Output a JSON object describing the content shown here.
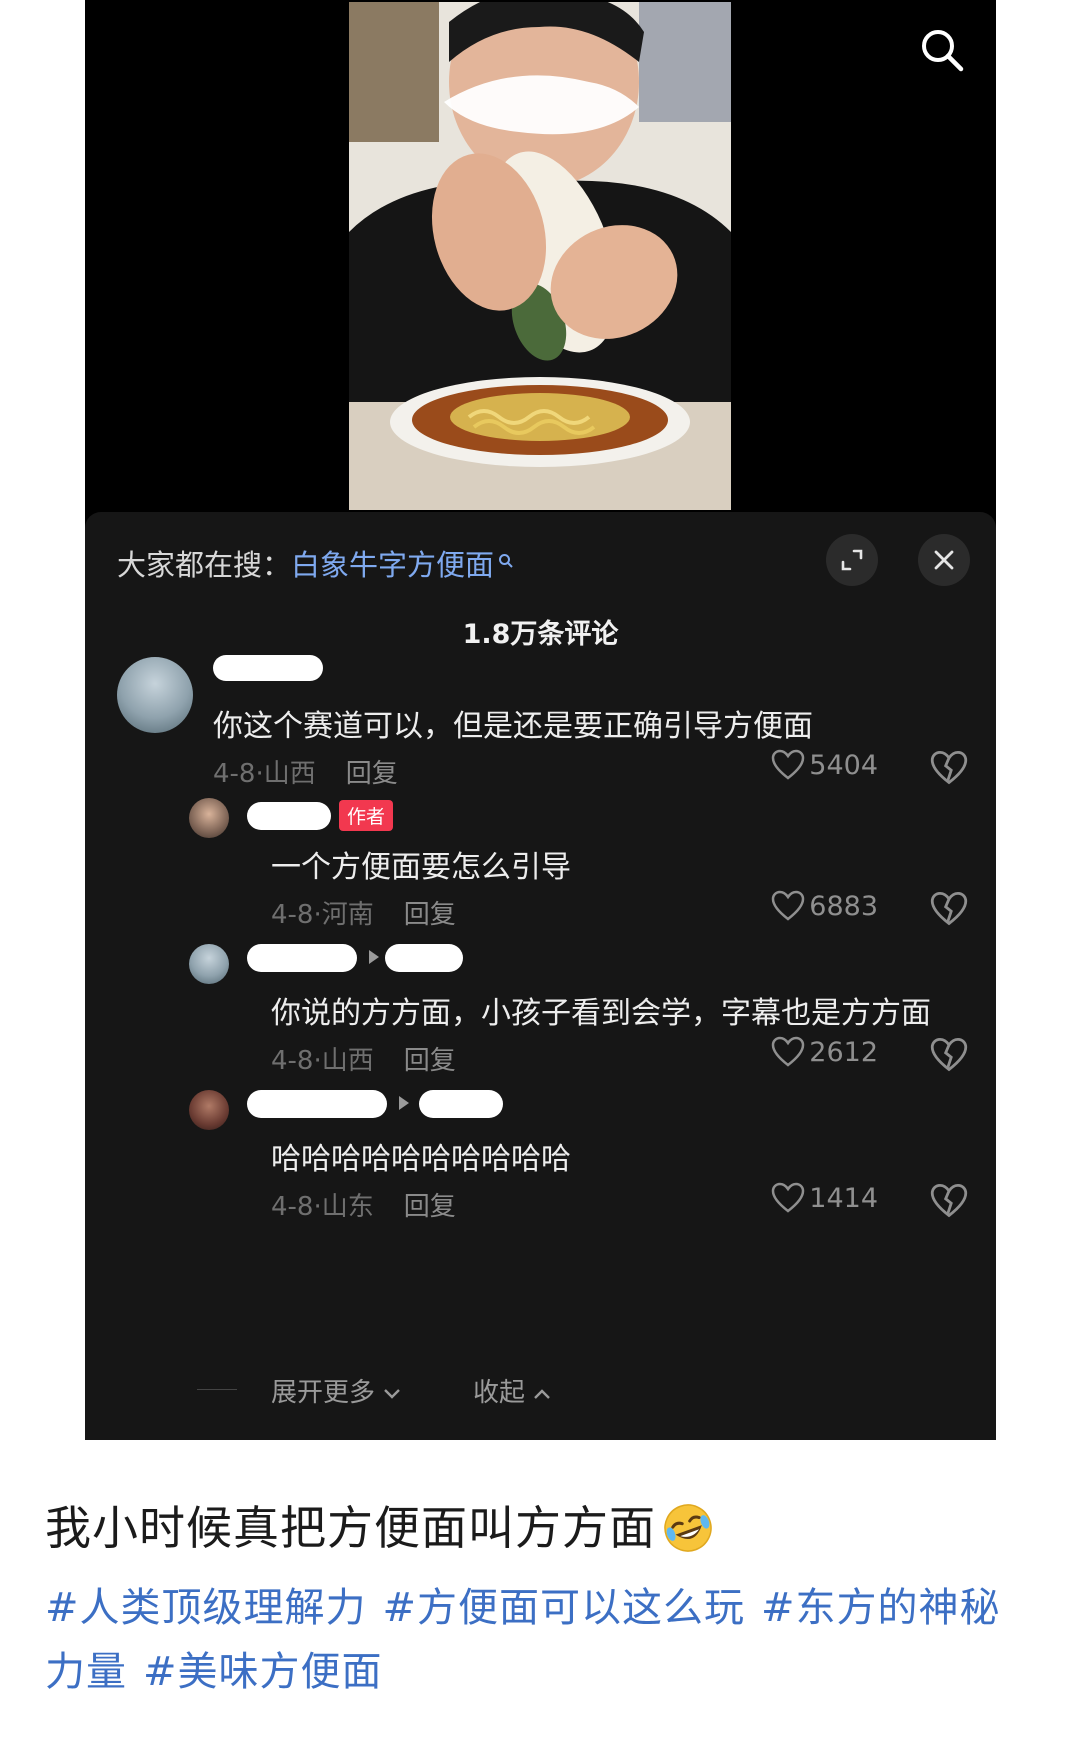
{
  "panel": {
    "hot_search_prefix": "大家都在搜：",
    "hot_search_term": "白象牛字方便面",
    "comment_count": "1.8万条评论"
  },
  "comments": [
    {
      "text": "你这个赛道可以，但是还是要正确引导方便面",
      "date": "4-8",
      "location": "山西",
      "reply_label": "回复",
      "likes": "5404"
    },
    {
      "badge": "作者",
      "text": "一个方便面要怎么引导",
      "date": "4-8",
      "location": "河南",
      "reply_label": "回复",
      "likes": "6883"
    },
    {
      "text": "你说的方方面，小孩子看到会学，字幕也是方方面",
      "date": "4-8",
      "location": "山西",
      "reply_label": "回复",
      "likes": "2612"
    },
    {
      "text": "哈哈哈哈哈哈哈哈哈哈",
      "date": "4-8",
      "location": "山东",
      "reply_label": "回复",
      "likes": "1414"
    }
  ],
  "footer": {
    "expand_more": "展开更多",
    "collapse": "收起"
  },
  "caption": "我小时候真把方便面叫方方面",
  "hashtags": [
    "#人类顶级理解力",
    "#方便面可以这么玩",
    "#东方的神秘力量",
    "#美味方便面"
  ],
  "colors": {
    "panel_bg": "#161616",
    "link_blue": "#7fa9ef",
    "hashtag_blue": "#3c6fc4",
    "author_badge": "#f2384f"
  },
  "icons": {
    "search": "search-icon",
    "expand": "expand-icon",
    "close": "close-icon",
    "like": "heart-icon",
    "dislike": "broken-heart-icon",
    "emoji": "rofl-emoji"
  }
}
